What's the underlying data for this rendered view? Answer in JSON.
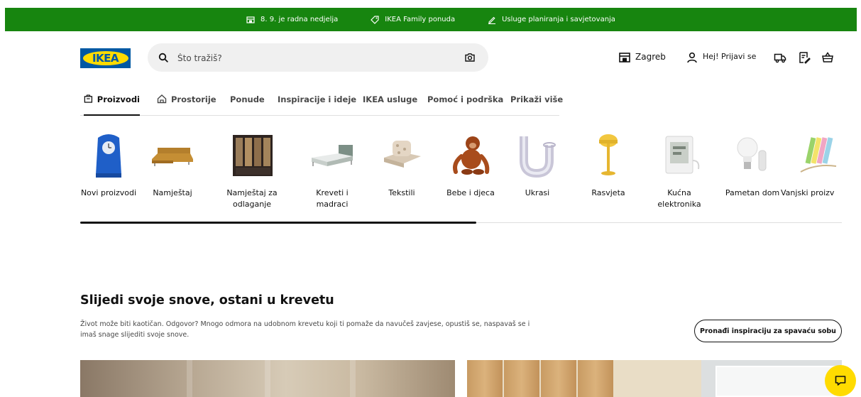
{
  "topbar": {
    "items": [
      {
        "label": "8. 9. je radna nedjelja",
        "icon": "store-icon"
      },
      {
        "label": "IKEA Family ponuda",
        "icon": "tag-icon"
      },
      {
        "label": "Usluge planiranja i savjetovanja",
        "icon": "pencil-icon"
      }
    ],
    "bg_color": "#17850f"
  },
  "header": {
    "logo_text": "IKEA",
    "search": {
      "placeholder": "Što tražiš?",
      "value": ""
    },
    "store_label": "Zagreb",
    "login_label": "Hej! Prijavi se",
    "icons": [
      "delivery-truck-icon",
      "shopping-list-icon",
      "shopping-bag-icon"
    ]
  },
  "tabs": [
    {
      "label": "Proizvodi",
      "icon": "box-icon",
      "active": true
    },
    {
      "label": "Prostorije",
      "icon": "house-icon",
      "active": false
    },
    {
      "label": "Ponude",
      "active": false
    },
    {
      "label": "Inspiracije i ideje",
      "active": false
    },
    {
      "label": "IKEA usluge",
      "active": false
    },
    {
      "label": "Pomoć i podrška",
      "active": false
    },
    {
      "label": "Prikaži više",
      "active": false
    }
  ],
  "categories": [
    {
      "label": "Novi proizvodi"
    },
    {
      "label": "Namještaj"
    },
    {
      "label": "Namještaj za odlaganje"
    },
    {
      "label": "Kreveti i madraci"
    },
    {
      "label": "Tekstili"
    },
    {
      "label": "Bebe i djeca"
    },
    {
      "label": "Ukrasi"
    },
    {
      "label": "Rasvjeta"
    },
    {
      "label": "Kućna elektronika"
    },
    {
      "label": "Pametan dom"
    },
    {
      "label": "Vanjski proizv"
    }
  ],
  "carousel_progress": 0.52,
  "inspiration": {
    "title": "Slijedi svoje snove, ostani u krevetu",
    "description": "Život može biti kaotičan. Odgovor? Mnogo odmora na udobnom krevetu koji ti pomaže da navučeš zavjese, opustiš se, naspavaš se i imaš snage slijediti svoje snove.",
    "cta_label": "Pronađi inspiraciju za spavaću sobu"
  },
  "colors": {
    "brand_blue": "#0058a3",
    "brand_yellow": "#ffdb00"
  }
}
